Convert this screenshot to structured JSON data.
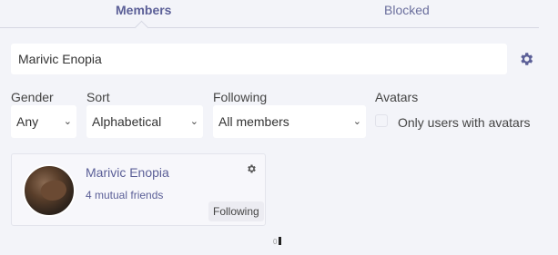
{
  "tabs": {
    "members": "Members",
    "blocked": "Blocked"
  },
  "search": {
    "value": "Marivic Enopia"
  },
  "filters": {
    "gender_label": "Gender",
    "gender_value": "Any",
    "sort_label": "Sort",
    "sort_value": "Alphabetical",
    "following_label": "Following",
    "following_value": "All members",
    "avatars_label": "Avatars",
    "avatars_option": "Only users with avatars"
  },
  "member": {
    "name": "Marivic Enopia",
    "mutual": "4 mutual friends",
    "status": "Following"
  },
  "pager": {
    "text": "0"
  },
  "colors": {
    "accent": "#5b5f97",
    "background": "#f3f4f9"
  }
}
